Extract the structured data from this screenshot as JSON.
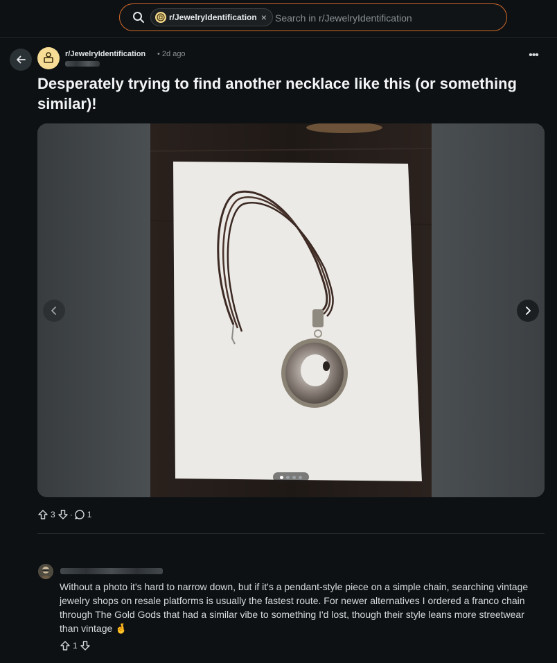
{
  "search": {
    "chip_label": "r/JewelryIdentification",
    "chip_close": "×",
    "placeholder": "Search in r/JewelryIdentification"
  },
  "post": {
    "subreddit": "r/JewelryIdentification",
    "age": "• 2d ago",
    "more": "•••",
    "title": "Desperately trying to find another necklace like this (or something similar)!",
    "upvotes": "3",
    "comments": "1",
    "gallery": {
      "slides": 4,
      "current": 1
    }
  },
  "comment": {
    "body": "Without a photo it's hard to narrow down, but if it's a pendant-style piece on a simple chain, searching vintage jewelry shops on resale platforms is usually the fastest route. For newer alternatives I ordered a franco chain through The Gold Gods that had a similar vibe to something I'd lost, though their style leans more streetwear than vintage 🤞",
    "upvotes": "1"
  },
  "colors": {
    "background": "#0e1113",
    "search_border": "#d2692a",
    "subreddit_avatar": "#f6dc95"
  },
  "icons": [
    "search-icon",
    "back-arrow-icon",
    "more-icon",
    "chevron-left-icon",
    "chevron-right-icon",
    "upvote-icon",
    "downvote-icon",
    "comment-icon"
  ]
}
